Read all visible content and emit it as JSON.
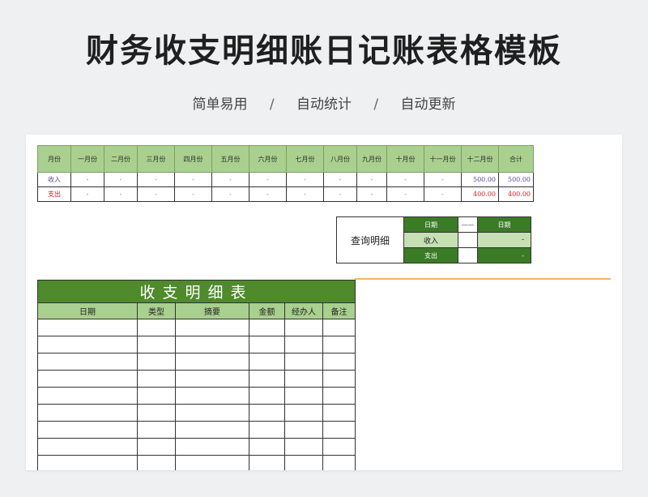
{
  "title": "财务收支明细账日记账表格模板",
  "subtitle": {
    "items": [
      "简单易用",
      "自动统计",
      "自动更新"
    ],
    "separator": "/"
  },
  "summary": {
    "columns": [
      "月份",
      "一月份",
      "二月份",
      "三月份",
      "四月份",
      "五月份",
      "六月份",
      "七月份",
      "八月份",
      "九月份",
      "十月份",
      "十一月份",
      "十二月份",
      "合计"
    ],
    "rows": [
      {
        "label": "收入",
        "values": [
          "-",
          "-",
          "-",
          "-",
          "-",
          "-",
          "-",
          "-",
          "-",
          "-",
          "-",
          "500.00",
          "500.00"
        ]
      },
      {
        "label": "支出",
        "values": [
          "-",
          "-",
          "-",
          "-",
          "-",
          "-",
          "-",
          "-",
          "-",
          "-",
          "-",
          "400.00",
          "400.00"
        ]
      }
    ]
  },
  "query": {
    "title": "查询明细",
    "date_label_left": "日期",
    "connector": "——",
    "date_label_right": "日期",
    "income_label": "收入",
    "income_value": "-",
    "expense_label": "支出",
    "expense_value": "-"
  },
  "detail": {
    "banner": "收支明细表",
    "columns": [
      "日期",
      "类型",
      "摘要",
      "金额",
      "经办人",
      "备注"
    ],
    "empty_rows": 9
  },
  "colors": {
    "header_green": "#a9d08e",
    "dark_green": "#4f8a2c",
    "income_purple": "#5a4a8a",
    "expense_red": "#d02020",
    "accent_orange": "#f0b95a"
  }
}
